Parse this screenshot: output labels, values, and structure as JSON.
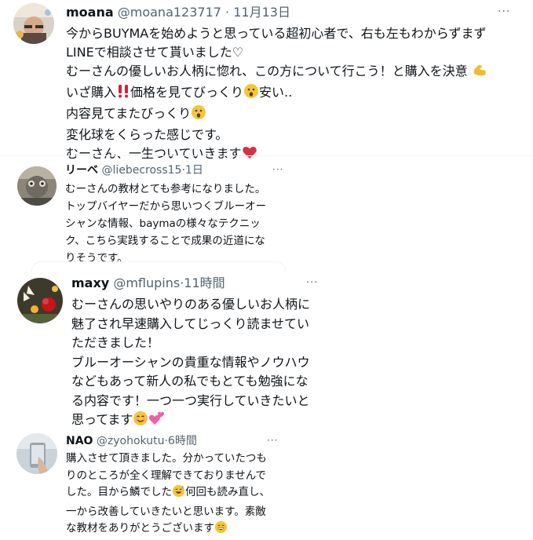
{
  "tweets": [
    {
      "name": "moana",
      "handle": "@moana123717",
      "separator": "·",
      "time": "11月13日",
      "lines": [
        {
          "text": "今からBUYMAを始めようと思っている超初心者で、右も左もわからずまず"
        },
        {
          "text": "LINEで相談させて貰いました♡"
        },
        {
          "text": "むーさんの優しいお人柄に惚れ、この方について行こう！と購入を決意",
          "emoji_after": "muscle"
        },
        {
          "text": "いざ購入",
          "emoji_after": "double-exclamation",
          "text2": "価格を見てびっくり",
          "emoji_after2": "surprised",
          "text3": "安い.."
        },
        {
          "text": "内容見てまたびっくり",
          "emoji_after": "surprised"
        },
        {
          "text": "変化球をくらった感じです。"
        },
        {
          "text": "むーさん、一生ついていきます",
          "emoji_after": "red-heart"
        }
      ]
    },
    {
      "name": "リーベ",
      "handle": "@liebecross15",
      "separator": "·",
      "time": "1日",
      "lines": [
        {
          "text": "むーさんの教材とても参考になりました。"
        },
        {
          "text": "トップバイヤーだから思いつくブルーオー"
        },
        {
          "text": "シャンな情報、baymaの様々なテクニッ"
        },
        {
          "text": "ク、こちら実践することで成果の近道にな"
        },
        {
          "text": "りそうです。"
        }
      ]
    },
    {
      "name": "maxy",
      "handle": "@mflupins",
      "separator": "·",
      "time": "11時間",
      "lines": [
        {
          "text": "むーさんの思いやりのある優しいお人柄に"
        },
        {
          "text": "魅了され早速購入してじっくり読ませてい"
        },
        {
          "text": "ただきました！"
        },
        {
          "text": "ブルーオーシャンの貴重な情報やノウハウ"
        },
        {
          "text": "などもあって新人の私でもとても勉強にな"
        },
        {
          "text": "る内容です！一つ一つ実行していきたいと"
        },
        {
          "text": "思ってます",
          "emoji_after": "smiling",
          "emoji_after2": "two-hearts"
        }
      ]
    },
    {
      "name": "NAO",
      "handle": "@zyohokutu",
      "separator": "·",
      "time": "6時間",
      "lines": [
        {
          "text": "購入させて頂きました。分かっていたつも"
        },
        {
          "text": "りのところが全く理解できておりませんで"
        },
        {
          "text": "した。目から鱗でした",
          "emoji_after": "sweat-smile",
          "text2": "何回も読み直し、"
        },
        {
          "text": "一から改善していきたいと思います。素敵"
        },
        {
          "text": "な教材をありがとうございます",
          "emoji_after": "grinning"
        }
      ]
    }
  ],
  "more_icon_glyph": "···",
  "colors": {
    "text_primary": "#0f1419",
    "text_secondary": "#536471",
    "divider": "#eff3f4"
  }
}
